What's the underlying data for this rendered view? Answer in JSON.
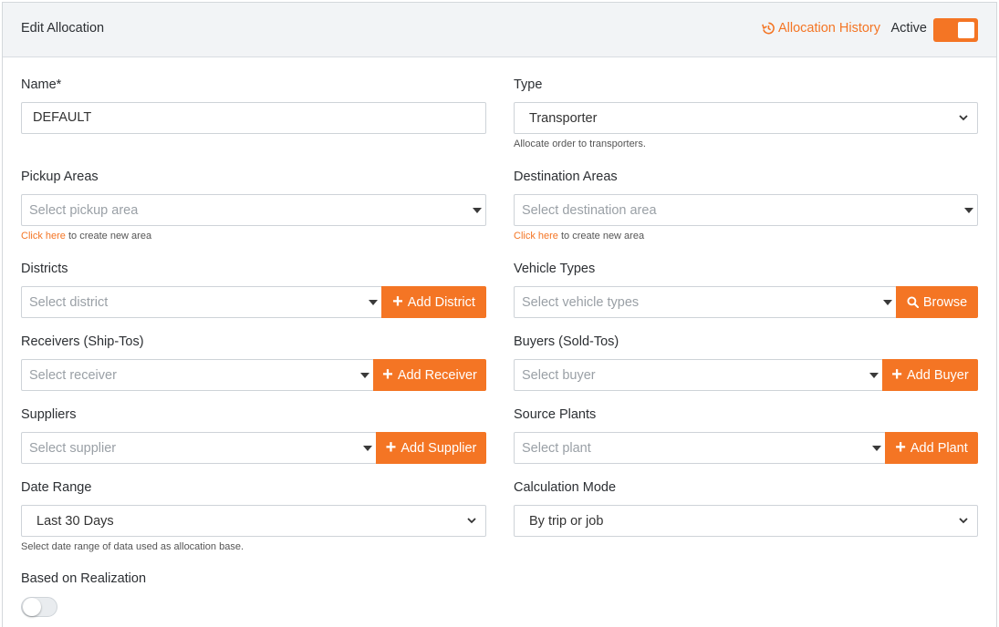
{
  "header": {
    "title": "Edit Allocation",
    "history_link": "Allocation History",
    "active_label": "Active",
    "active": true
  },
  "form": {
    "name": {
      "label": "Name*",
      "value": "DEFAULT"
    },
    "type": {
      "label": "Type",
      "value": "Transporter",
      "help": "Allocate order to transporters."
    },
    "pickup_areas": {
      "label": "Pickup Areas",
      "placeholder": "Select pickup area",
      "help_link": "Click here",
      "help_text": " to create new area"
    },
    "destination_areas": {
      "label": "Destination Areas",
      "placeholder": "Select destination area",
      "help_link": "Click here",
      "help_text": " to create new area"
    },
    "districts": {
      "label": "Districts",
      "placeholder": "Select district",
      "button": "Add District"
    },
    "vehicle_types": {
      "label": "Vehicle Types",
      "placeholder": "Select vehicle types",
      "button": "Browse"
    },
    "receivers": {
      "label": "Receivers (Ship-Tos)",
      "placeholder": "Select receiver",
      "button": "Add Receiver"
    },
    "buyers": {
      "label": "Buyers (Sold-Tos)",
      "placeholder": "Select buyer",
      "button": "Add Buyer"
    },
    "suppliers": {
      "label": "Suppliers",
      "placeholder": "Select supplier",
      "button": "Add Supplier"
    },
    "source_plants": {
      "label": "Source Plants",
      "placeholder": "Select plant",
      "button": "Add Plant"
    },
    "date_range": {
      "label": "Date Range",
      "value": "Last 30 Days",
      "help": "Select date range of data used as allocation base."
    },
    "calculation_mode": {
      "label": "Calculation Mode",
      "value": "By trip or job"
    },
    "based_on_realization": {
      "label": "Based on Realization",
      "enabled": false
    }
  },
  "colors": {
    "accent": "#f47524",
    "header_bg": "#f2f4f6",
    "border": "#ced3d8"
  },
  "icons": {
    "history": "history-icon",
    "plus": "plus-icon",
    "search": "search-icon",
    "chevron": "chevron-down-icon",
    "caret": "caret-down-icon"
  }
}
